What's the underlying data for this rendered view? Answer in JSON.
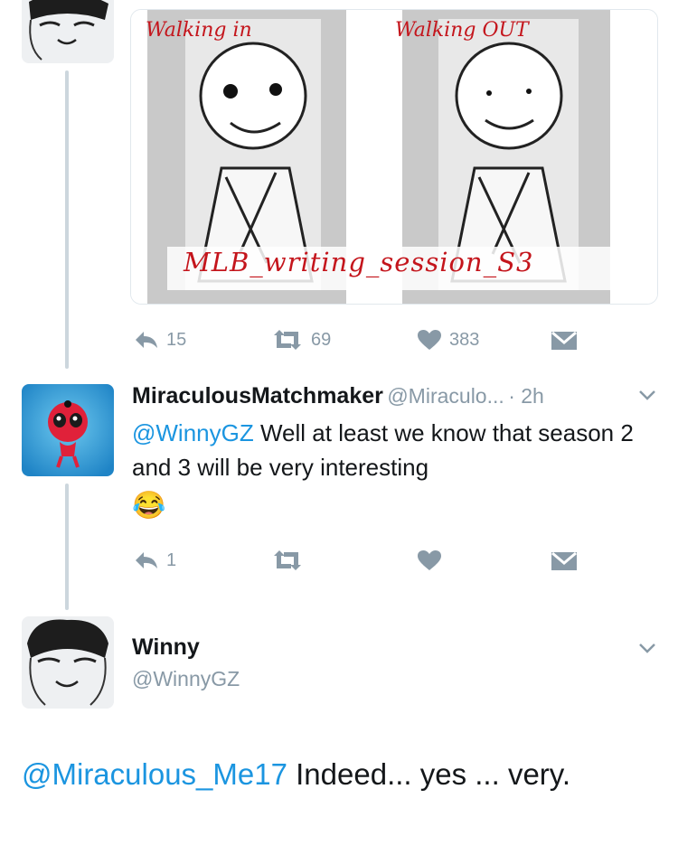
{
  "tweet1": {
    "actions": {
      "reply_count": "15",
      "retweet_count": "69",
      "like_count": "383"
    },
    "media": {
      "label_left": "Walking in",
      "label_right": "Walking OUT",
      "caption": "MLB_writing_session_S3"
    }
  },
  "tweet2": {
    "name": "MiraculousMatchmaker",
    "handle": "@Miraculo...",
    "time": "· 2h",
    "mention": "@WinnyGZ",
    "text": " Well at least we know that season 2 and 3 will be very interesting",
    "emoji": "😂",
    "actions": {
      "reply_count": "1"
    }
  },
  "tweet3": {
    "name": "Winny",
    "handle": "@WinnyGZ",
    "mention": "@Miraculous_Me17",
    "text": " Indeed... yes ... very."
  },
  "colors": {
    "link": "#1b95e0",
    "muted": "#8899a6",
    "line": "#ccd6dd",
    "drawing_red": "#c4151c"
  },
  "icons": [
    "reply-icon",
    "retweet-icon",
    "heart-icon",
    "dm-envelope-icon",
    "chevron-down-icon"
  ]
}
